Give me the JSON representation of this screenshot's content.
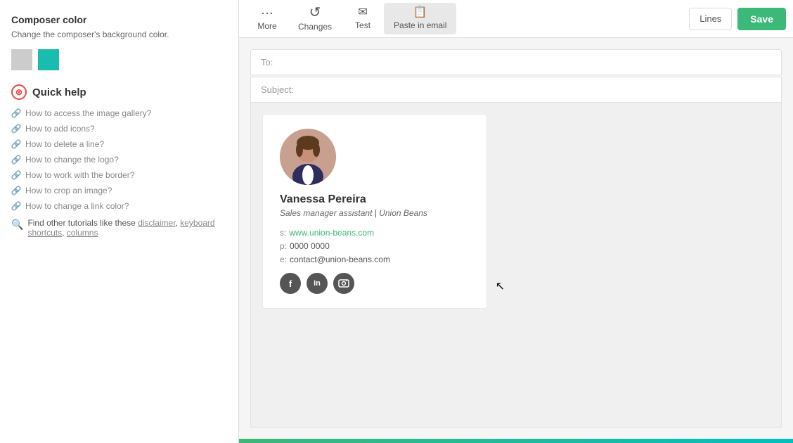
{
  "sidebar": {
    "composer_color_title": "Composer color",
    "composer_color_desc": "Change the composer's background color.",
    "color_swatch_light": "#cccccc",
    "color_swatch_accent": "#1abcb0",
    "quick_help_title": "Quick help",
    "help_links": [
      "How to access the image gallery?",
      "How to add icons?",
      "How to delete a line?",
      "How to change the logo?",
      "How to work with the border?",
      "How to crop an image?",
      "How to change a link color?"
    ],
    "find_tutorials_text": "Find other tutorials like these",
    "tutorials_links": [
      "disclaimer",
      "keyboard shortcuts",
      "columns"
    ]
  },
  "toolbar": {
    "more_label": "More",
    "changes_label": "Changes",
    "test_label": "Test",
    "paste_label": "Paste in email",
    "lines_label": "Lines",
    "save_label": "Save",
    "more_icon": "···",
    "changes_icon": "↺",
    "test_icon": "✉",
    "paste_icon": "📋"
  },
  "email": {
    "to_placeholder": "To:",
    "subject_placeholder": "Subject:"
  },
  "signature": {
    "name": "Vanessa Pereira",
    "title": "Sales manager assistant | Union Beans",
    "website_label": "s:",
    "website_url": "www.union-beans.com",
    "phone_label": "p:",
    "phone": "0000 0000",
    "email_label": "e:",
    "email": "contact@union-beans.com",
    "social": [
      "f",
      "in",
      "📷"
    ]
  }
}
